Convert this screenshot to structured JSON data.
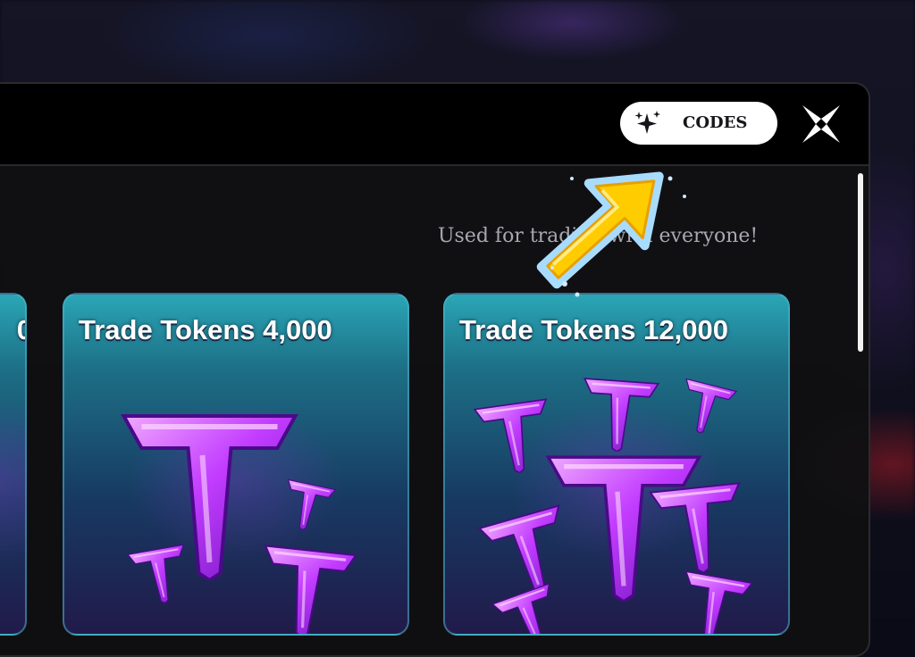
{
  "header": {
    "codes_button": {
      "label": "CODES",
      "icon": "sparkle-icon"
    },
    "close_button": {
      "icon": "close-x-icon"
    }
  },
  "subtitle": "Used for trading with everyone!",
  "cards": [
    {
      "title": "0",
      "item": "trade-token"
    },
    {
      "title": "Trade Tokens 4,000",
      "item": "trade-token"
    },
    {
      "title": "Trade Tokens 12,000",
      "item": "trade-token"
    }
  ],
  "colors": {
    "token_purple": "#c23cff",
    "card_teal": "#2aa6b6",
    "arrow_yellow": "#ffcc00",
    "arrow_blue": "#2f6fe6"
  }
}
